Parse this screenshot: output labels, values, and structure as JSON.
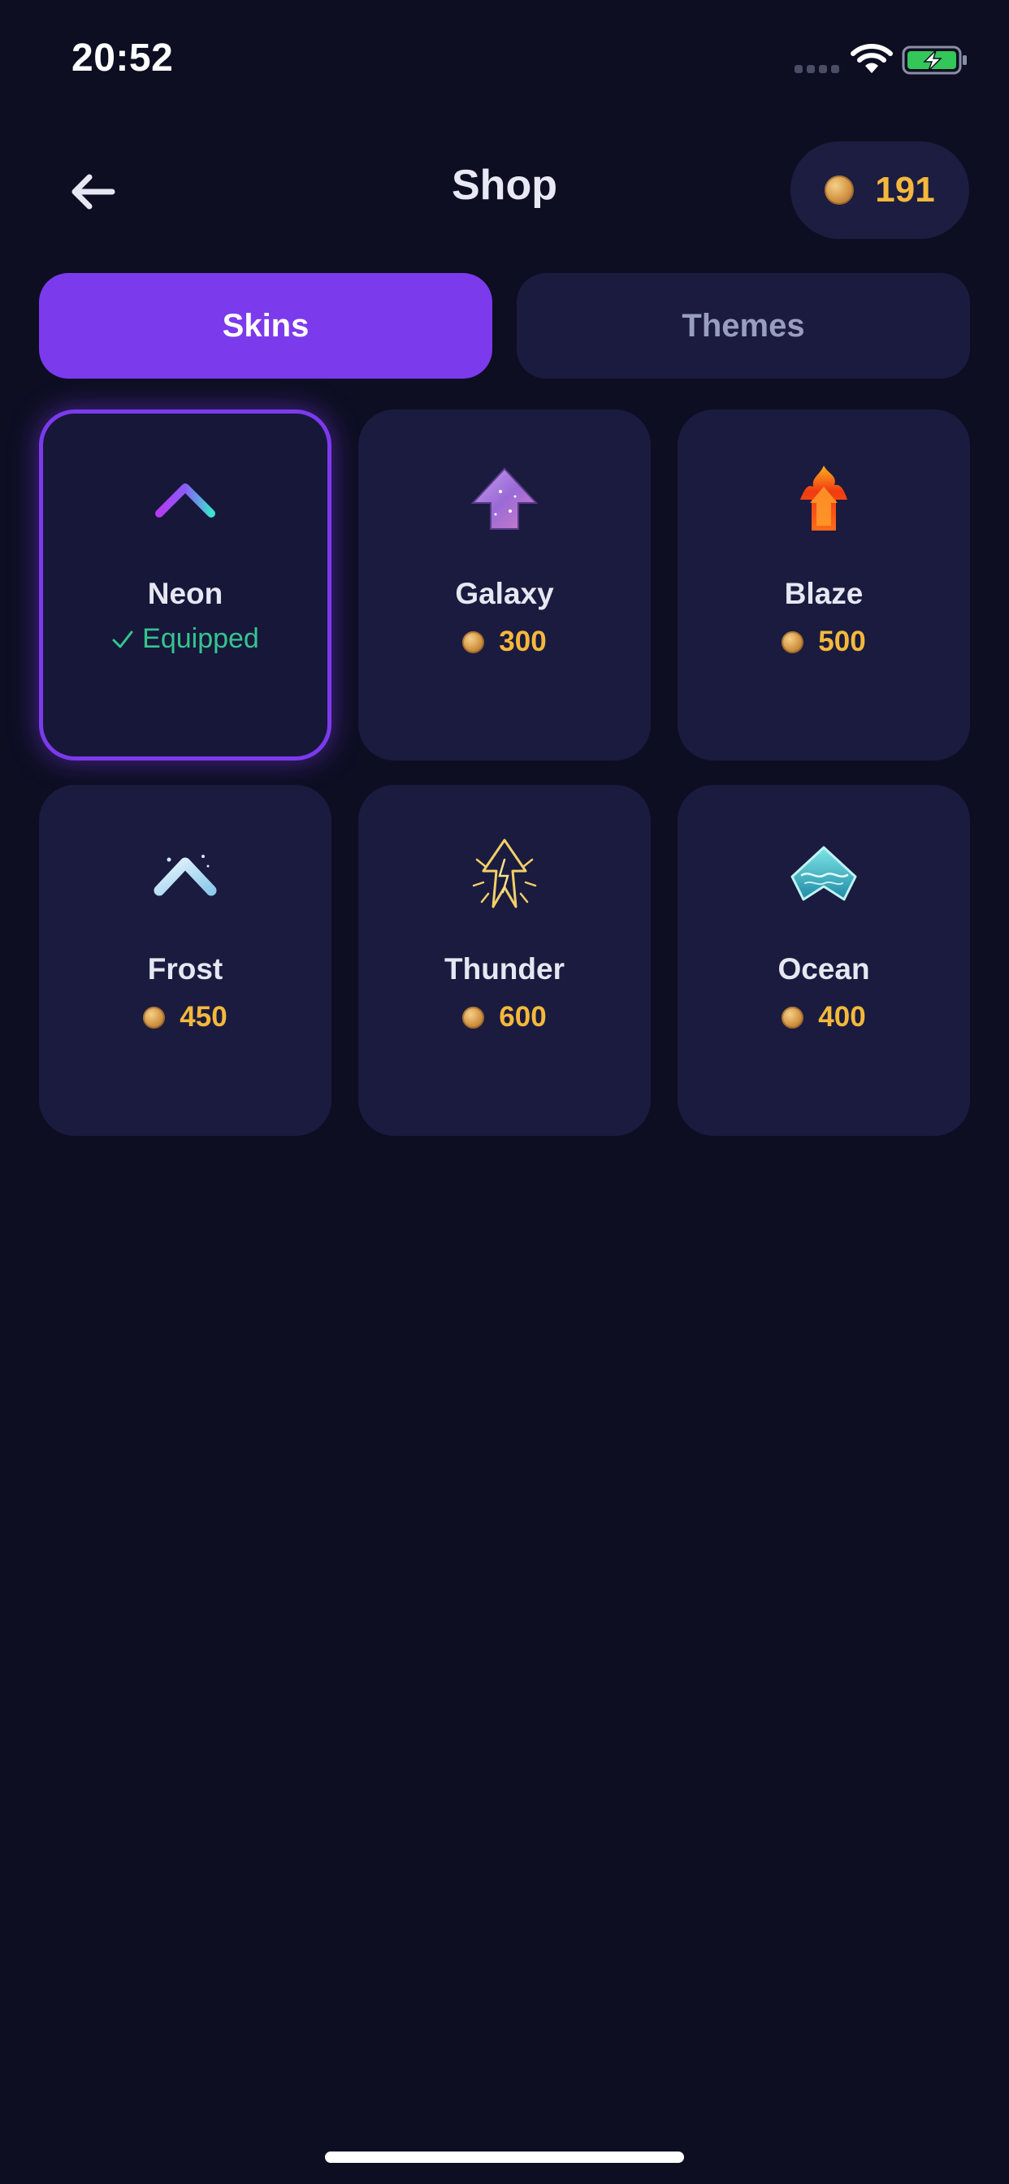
{
  "status_bar": {
    "time": "20:52"
  },
  "header": {
    "title": "Shop",
    "coins": "191"
  },
  "tabs": [
    {
      "label": "Skins",
      "active": true
    },
    {
      "label": "Themes",
      "active": false
    }
  ],
  "skins": [
    {
      "name": "Neon",
      "status": "Equipped",
      "icon": "neon-chevron-icon"
    },
    {
      "name": "Galaxy",
      "price": "300",
      "icon": "galaxy-arrow-icon"
    },
    {
      "name": "Blaze",
      "price": "500",
      "icon": "fire-arrow-icon"
    },
    {
      "name": "Frost",
      "price": "450",
      "icon": "frost-chevron-icon"
    },
    {
      "name": "Thunder",
      "price": "600",
      "icon": "lightning-arrow-icon"
    },
    {
      "name": "Ocean",
      "price": "400",
      "icon": "ocean-diamond-icon"
    }
  ],
  "colors": {
    "background": "#0d0e22",
    "card": "#1a1b3e",
    "accent": "#7c3aed",
    "coin_text": "#f5b83c",
    "equipped_text": "#35c48f"
  }
}
